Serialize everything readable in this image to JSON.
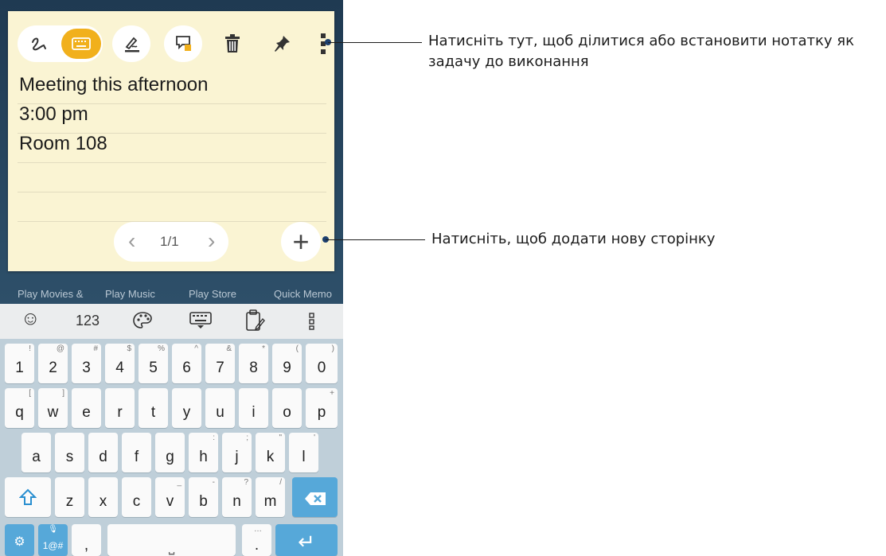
{
  "note": {
    "toolbar_icons": [
      "handwriting-icon",
      "keyboard-icon",
      "pen-style-icon",
      "note-color-icon",
      "trash-icon",
      "pin-icon",
      "more-icon"
    ],
    "lines": [
      "Meeting  this  afternoon",
      "3:00 pm",
      "Room 108"
    ],
    "pager": {
      "prev": "‹",
      "count": "1/1",
      "next": "›"
    },
    "add_page": "+"
  },
  "apps": [
    "Play Movies &",
    "Play Music",
    "Play Store",
    "Quick Memo"
  ],
  "keyboard": {
    "toolbar": {
      "emoji": "☺",
      "numbers": "123",
      "theme_icon": "palette-icon",
      "keyboard_icon": "keyboard-icon",
      "clipboard_icon": "clipboard-icon",
      "more_icon": "more-icon"
    },
    "row1": [
      {
        "main": "1",
        "sub": "!"
      },
      {
        "main": "2",
        "sub": "@"
      },
      {
        "main": "3",
        "sub": "#"
      },
      {
        "main": "4",
        "sub": "$"
      },
      {
        "main": "5",
        "sub": "%"
      },
      {
        "main": "6",
        "sub": "^"
      },
      {
        "main": "7",
        "sub": "&"
      },
      {
        "main": "8",
        "sub": "*"
      },
      {
        "main": "9",
        "sub": "("
      },
      {
        "main": "0",
        "sub": ")"
      }
    ],
    "row2": [
      {
        "main": "q",
        "sub": "["
      },
      {
        "main": "w",
        "sub": "]"
      },
      {
        "main": "e",
        "sub": ""
      },
      {
        "main": "r",
        "sub": ""
      },
      {
        "main": "t",
        "sub": ""
      },
      {
        "main": "y",
        "sub": ""
      },
      {
        "main": "u",
        "sub": ""
      },
      {
        "main": "i",
        "sub": ""
      },
      {
        "main": "o",
        "sub": ""
      },
      {
        "main": "p",
        "sub": "+"
      }
    ],
    "row3": [
      {
        "main": "a",
        "sub": ""
      },
      {
        "main": "s",
        "sub": ""
      },
      {
        "main": "d",
        "sub": ""
      },
      {
        "main": "f",
        "sub": ""
      },
      {
        "main": "g",
        "sub": ""
      },
      {
        "main": "h",
        "sub": ":"
      },
      {
        "main": "j",
        "sub": ";"
      },
      {
        "main": "k",
        "sub": "\""
      },
      {
        "main": "l",
        "sub": "'"
      }
    ],
    "row4": [
      {
        "main": "z",
        "sub": ""
      },
      {
        "main": "x",
        "sub": ""
      },
      {
        "main": "c",
        "sub": ""
      },
      {
        "main": "v",
        "sub": "_"
      },
      {
        "main": "b",
        "sub": "-"
      },
      {
        "main": "n",
        "sub": "?"
      },
      {
        "main": "m",
        "sub": "/"
      }
    ],
    "row5": {
      "settings": "⚙",
      "symbols": "1@#",
      "comma": ",",
      "space": "⎵",
      "period": ".",
      "period_sub": "…",
      "enter": "↵"
    }
  },
  "callouts": {
    "more": "Натисніть тут, щоб ділитися або встановити нотатку як задачу до виконання",
    "add_page": "Натисніть, щоб додати нову сторінку"
  },
  "colors": {
    "accent": "#f1b01c",
    "note_bg": "#faf4d3",
    "key_blue": "#56a8d9"
  }
}
